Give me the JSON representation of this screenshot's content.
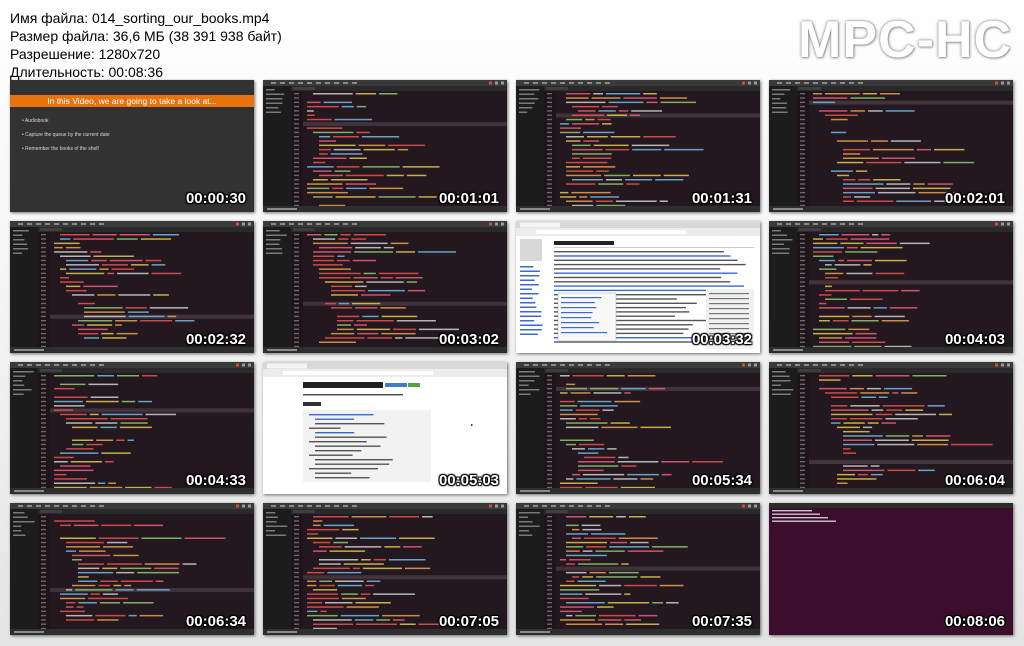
{
  "info": {
    "filename": "Имя файла: 014_sorting_our_books.mp4",
    "filesize": "Размер файла: 36,6 МБ (38 391 938 байт)",
    "resolution": "Разрешение: 1280x720",
    "duration": "Длительность: 00:08:36"
  },
  "logo": "MPC-HC",
  "slide": {
    "heading": "In this Video, we are going to take a look at...",
    "bullets": [
      "Audiobook",
      "Capture the queue by the current date",
      "Remember the books of the shelf"
    ]
  },
  "thumbnails": [
    {
      "time": "00:00:30",
      "kind": "slide"
    },
    {
      "time": "00:01:01",
      "kind": "code"
    },
    {
      "time": "00:01:31",
      "kind": "code"
    },
    {
      "time": "00:02:01",
      "kind": "code"
    },
    {
      "time": "00:02:32",
      "kind": "code"
    },
    {
      "time": "00:03:02",
      "kind": "code"
    },
    {
      "time": "00:03:32",
      "kind": "browser-wiki"
    },
    {
      "time": "00:04:03",
      "kind": "code"
    },
    {
      "time": "00:04:33",
      "kind": "code"
    },
    {
      "time": "00:05:03",
      "kind": "browser-docs"
    },
    {
      "time": "00:05:34",
      "kind": "code"
    },
    {
      "time": "00:06:04",
      "kind": "code"
    },
    {
      "time": "00:06:34",
      "kind": "code"
    },
    {
      "time": "00:07:05",
      "kind": "code"
    },
    {
      "time": "00:07:35",
      "kind": "code"
    },
    {
      "time": "00:08:06",
      "kind": "terminal"
    }
  ],
  "colors": {
    "editor_bg": "#241820",
    "sidebar_bg": "#1c1c1c",
    "titlebar": "#3a3a3a",
    "terminal_bg": "#3a0e2c",
    "slide_accent": "#e8720c"
  }
}
